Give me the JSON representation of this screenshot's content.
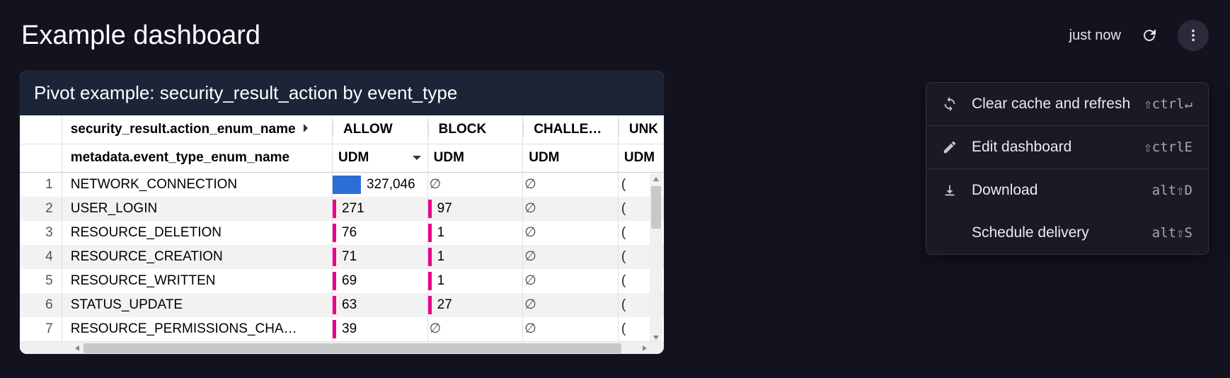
{
  "header": {
    "title": "Example dashboard",
    "timestamp": "just now"
  },
  "panel": {
    "title": "Pivot example: security_result_action by event_type",
    "pivot_field_label": "security_result.action_enum_name",
    "row_field_label": "metadata.event_type_enum_name",
    "measure_label": "UDM",
    "columns": [
      "ALLOW",
      "BLOCK",
      "CHALLE…",
      "UNK"
    ],
    "rows": [
      {
        "n": 1,
        "name": "NETWORK_CONNECTION",
        "allow": "327,046",
        "allow_bar": "blue-big",
        "block": "∅",
        "block_bar": "",
        "chal": "∅",
        "unk": "("
      },
      {
        "n": 2,
        "name": "USER_LOGIN",
        "allow": "271",
        "allow_bar": "pink",
        "block": "97",
        "block_bar": "pink",
        "chal": "∅",
        "unk": "("
      },
      {
        "n": 3,
        "name": "RESOURCE_DELETION",
        "allow": "76",
        "allow_bar": "pink",
        "block": "1",
        "block_bar": "pink",
        "chal": "∅",
        "unk": "("
      },
      {
        "n": 4,
        "name": "RESOURCE_CREATION",
        "allow": "71",
        "allow_bar": "pink",
        "block": "1",
        "block_bar": "pink",
        "chal": "∅",
        "unk": "("
      },
      {
        "n": 5,
        "name": "RESOURCE_WRITTEN",
        "allow": "69",
        "allow_bar": "pink",
        "block": "1",
        "block_bar": "pink",
        "chal": "∅",
        "unk": "("
      },
      {
        "n": 6,
        "name": "STATUS_UPDATE",
        "allow": "63",
        "allow_bar": "pink",
        "block": "27",
        "block_bar": "pink",
        "chal": "∅",
        "unk": "("
      },
      {
        "n": 7,
        "name": "RESOURCE_PERMISSIONS_CHA…",
        "allow": "39",
        "allow_bar": "pink",
        "block": "∅",
        "block_bar": "",
        "chal": "∅",
        "unk": "("
      }
    ]
  },
  "menu": {
    "items": [
      {
        "icon": "refresh-sync",
        "label": "Clear cache and refresh",
        "shortcut": "⇧ctrl↵"
      },
      {
        "icon": "pencil",
        "label": "Edit dashboard",
        "shortcut": "⇧ctrlE"
      },
      {
        "icon": "download",
        "label": "Download",
        "shortcut": "alt⇧D"
      },
      {
        "icon": "",
        "label": "Schedule delivery",
        "shortcut": "alt⇧S"
      }
    ]
  },
  "chart_data": {
    "type": "table",
    "title": "Pivot example: security_result_action by event_type",
    "row_dimension": "metadata.event_type_enum_name",
    "column_dimension": "security_result.action_enum_name",
    "measure": "UDM",
    "columns": [
      "ALLOW",
      "BLOCK",
      "CHALLENGE",
      "UNKNOWN"
    ],
    "rows": [
      {
        "event_type": "NETWORK_CONNECTION",
        "ALLOW": 327046,
        "BLOCK": null,
        "CHALLENGE": null
      },
      {
        "event_type": "USER_LOGIN",
        "ALLOW": 271,
        "BLOCK": 97,
        "CHALLENGE": null
      },
      {
        "event_type": "RESOURCE_DELETION",
        "ALLOW": 76,
        "BLOCK": 1,
        "CHALLENGE": null
      },
      {
        "event_type": "RESOURCE_CREATION",
        "ALLOW": 71,
        "BLOCK": 1,
        "CHALLENGE": null
      },
      {
        "event_type": "RESOURCE_WRITTEN",
        "ALLOW": 69,
        "BLOCK": 1,
        "CHALLENGE": null
      },
      {
        "event_type": "STATUS_UPDATE",
        "ALLOW": 63,
        "BLOCK": 27,
        "CHALLENGE": null
      },
      {
        "event_type": "RESOURCE_PERMISSIONS_CHANGE",
        "ALLOW": 39,
        "BLOCK": null,
        "CHALLENGE": null
      }
    ]
  }
}
